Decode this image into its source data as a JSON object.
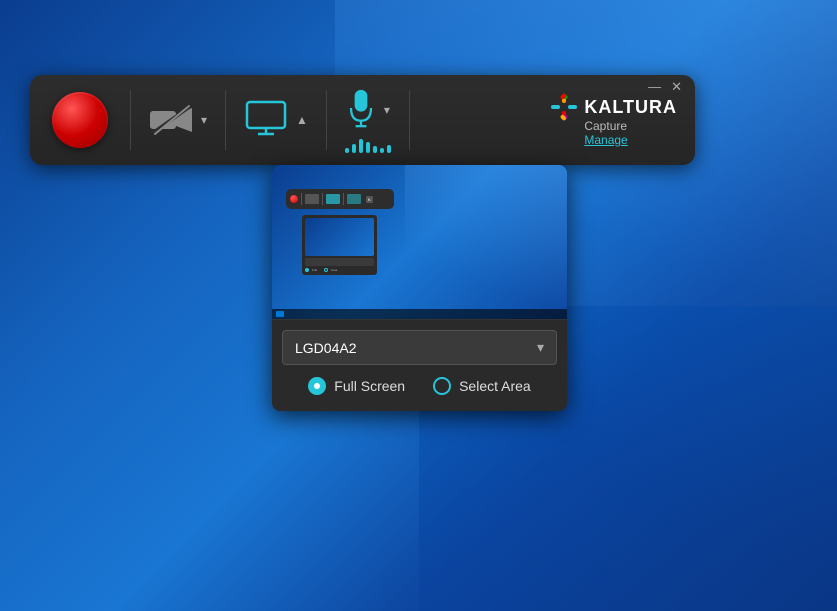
{
  "desktop": {
    "background_desc": "Windows 10 blue desktop"
  },
  "window_controls": {
    "minimize_label": "—",
    "close_label": "✕"
  },
  "toolbar": {
    "record_button_label": "Record",
    "camera_label": "Camera (disabled)",
    "monitor_label": "Screen",
    "mic_label": "Microphone",
    "dropdown_arrow": "▾",
    "up_arrow": "▲"
  },
  "brand": {
    "name": "KALTURA",
    "sub": "Capture",
    "manage_label": "Manage"
  },
  "screen_picker": {
    "monitor_name": "LGD04A2",
    "chevron": "▾",
    "full_screen_label": "Full Screen",
    "select_area_label": "Select Area",
    "full_screen_selected": true
  },
  "mic_bars": [
    5,
    8,
    12,
    9,
    6,
    4,
    7
  ]
}
